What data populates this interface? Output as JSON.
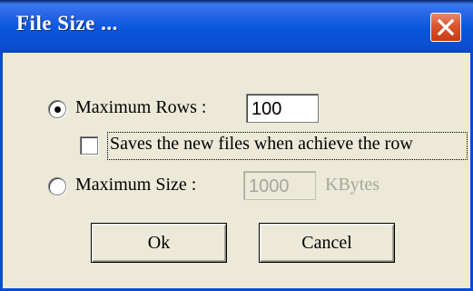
{
  "window": {
    "title": "File Size ..."
  },
  "options": {
    "max_rows_label": "Maximum Rows :",
    "max_rows_value": "100",
    "max_rows_selected": true,
    "save_new_files_label": "Saves the new files when achieve the row",
    "save_new_files_checked": false,
    "max_size_label": "Maximum Size :",
    "max_size_value": "1000",
    "max_size_unit": "KBytes",
    "max_size_selected": false
  },
  "buttons": {
    "ok_label": "Ok",
    "cancel_label": "Cancel"
  },
  "colors": {
    "titlebar": "#0a4bd6",
    "dialog_bg": "#ece9d8",
    "disabled_text": "#a7a69a",
    "close_button": "#d9542d"
  },
  "icons": {
    "close": "close-icon"
  }
}
